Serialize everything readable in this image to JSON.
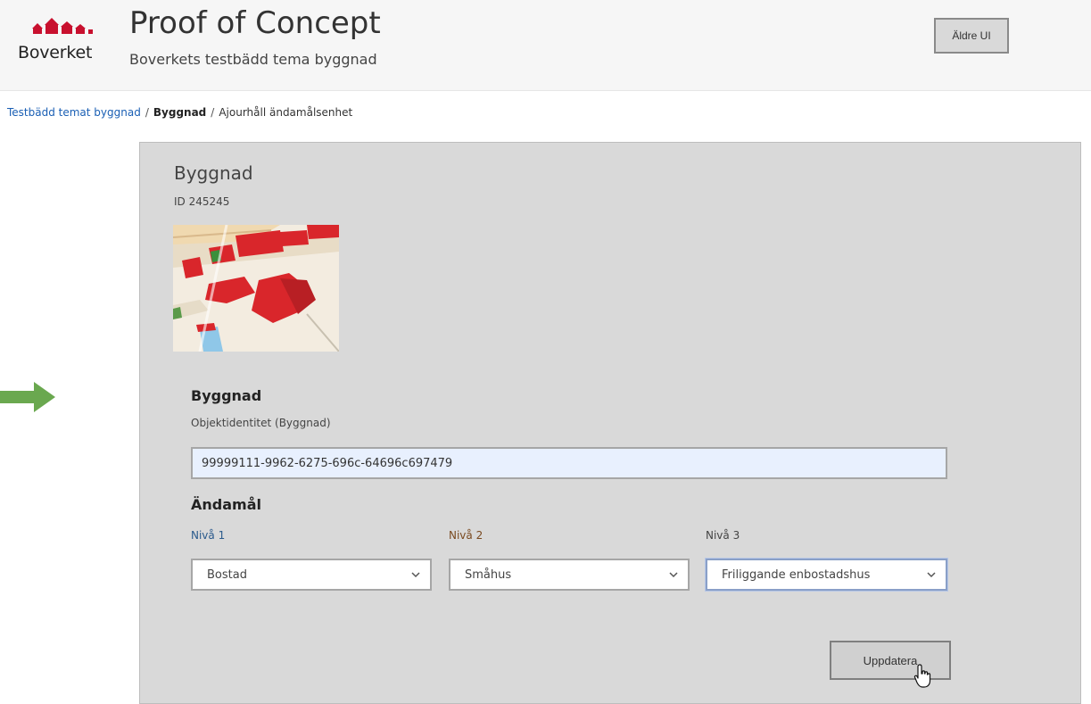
{
  "header": {
    "logo_text": "Boverket",
    "title": "Proof of Concept",
    "subtitle": "Boverkets testbädd tema byggnad",
    "legacy_button": "Äldre UI"
  },
  "breadcrumb": {
    "items": [
      "Testbädd temat byggnad",
      "Byggnad",
      "Ajourhåll ändamålsenhet"
    ],
    "separator": "/"
  },
  "panel": {
    "title": "Byggnad",
    "id_text": "ID 245245",
    "building_section": {
      "title": "Byggnad",
      "field_label": "Objektidentitet (Byggnad)",
      "field_value": "99999111-9962-6275-696c-64696c697479"
    },
    "purpose_section": {
      "title": "Ändamål",
      "levels": [
        {
          "label": "Nivå 1",
          "value": "Bostad"
        },
        {
          "label": "Nivå 2",
          "value": "Småhus"
        },
        {
          "label": "Nivå 3",
          "value": "Friliggande enbostadshus"
        }
      ]
    },
    "update_button": "Uppdatera"
  },
  "colors": {
    "brand_red": "#c8102e",
    "link_blue": "#1a5fb4",
    "arrow_green": "#6aa84f",
    "panel_bg": "#d9d9d9",
    "input_bg": "#e8f0fe"
  }
}
